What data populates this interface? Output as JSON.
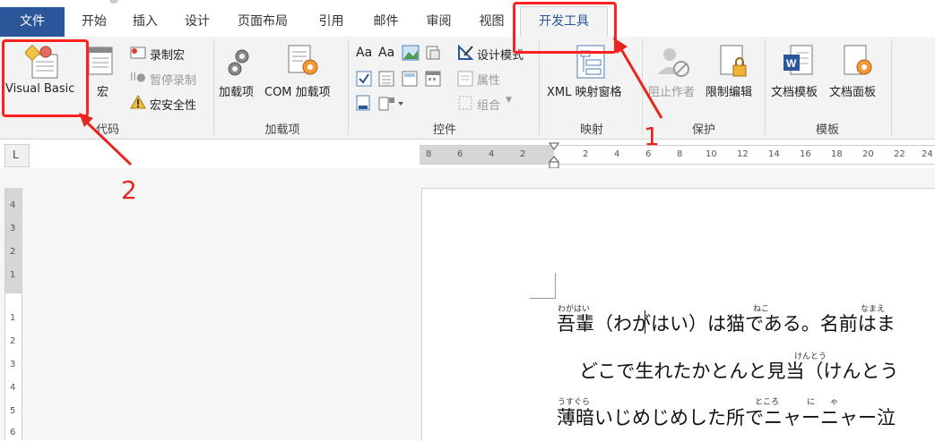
{
  "tabs": {
    "file": "文件",
    "home": "开始",
    "insert": "插入",
    "design": "设计",
    "layout": "页面布局",
    "references": "引用",
    "mailings": "邮件",
    "review": "审阅",
    "view": "视图",
    "developer": "开发工具"
  },
  "ribbon": {
    "code": {
      "label": "代码",
      "visual_basic": "Visual Basic",
      "macros": "宏",
      "record_macro": "录制宏",
      "pause_recording": "暂停录制",
      "macro_security": "宏安全性"
    },
    "addins": {
      "label": "加载项",
      "addins": "加载项",
      "com_addins": "COM 加载项"
    },
    "controls": {
      "label": "控件",
      "design_mode": "设计模式",
      "properties": "属性",
      "group": "组合"
    },
    "mapping": {
      "label": "映射",
      "xml_mapping": "XML 映射窗格"
    },
    "protect": {
      "label": "保护",
      "block_authors": "阻止作者",
      "restrict_editing": "限制编辑"
    },
    "templates": {
      "label": "模板",
      "document_template": "文档模板",
      "document_panel": "文档面板"
    }
  },
  "ruler": {
    "tab_selector": "L",
    "ticks": [
      "8",
      "6",
      "4",
      "2",
      "2",
      "4",
      "6",
      "8",
      "10",
      "12",
      "14",
      "16",
      "18",
      "20",
      "22",
      "24"
    ],
    "vticks": [
      "4",
      "3",
      "2",
      "1",
      "1",
      "2",
      "3",
      "4",
      "5",
      "6"
    ]
  },
  "document": {
    "line1": "吾輩（わがはい）は猫である。名前はま",
    "line2": "どこで生れたかとんと見当（けんとう",
    "line3": "薄暗いじめじめした所でニャーニャー泣",
    "ruby": {
      "wagahai": "わがはい",
      "neko": "ねこ",
      "namae": "なまえ",
      "kentou": "けんとう",
      "usugura": "うすぐら",
      "tokoro": "ところ",
      "ni": "に",
      "ya": "ゃ"
    }
  },
  "annotations": {
    "step1": "1",
    "step2": "2"
  },
  "colors": {
    "file_tab": "#2b579a",
    "annotation": "#ff2020",
    "ribbon_bg": "#f3f3f3"
  }
}
